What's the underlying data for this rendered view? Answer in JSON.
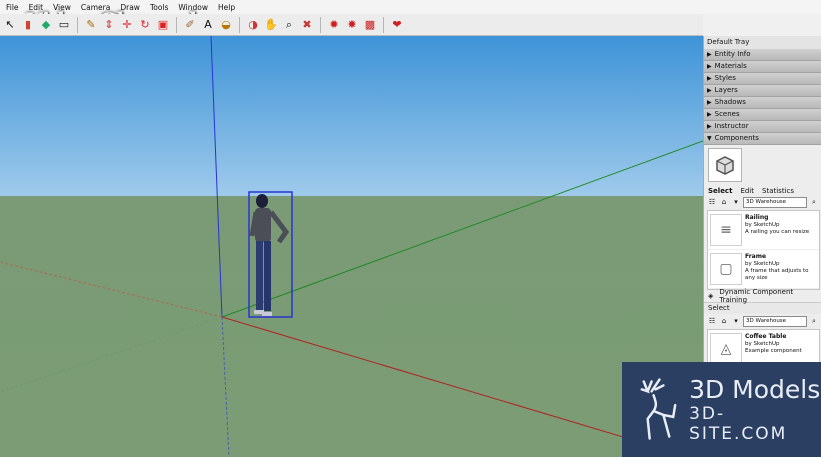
{
  "menu": [
    "File",
    "Edit",
    "View",
    "Camera",
    "Draw",
    "Tools",
    "Window",
    "Help"
  ],
  "toolbar_groups": [
    [
      "select-icon",
      "eraser-icon",
      "paint-bucket-icon",
      "rectangle-icon"
    ],
    [
      "pencil-icon",
      "push-pull-icon",
      "move-icon",
      "rotate-icon",
      "scale-icon"
    ],
    [
      "tape-measure-icon",
      "text-icon",
      "paint-icon"
    ],
    [
      "orbit-icon",
      "pan-icon",
      "zoom-icon",
      "zoom-extents-icon"
    ],
    [
      "warehouse-icon",
      "share-model-icon",
      "components-icon"
    ],
    [
      "extension-icon"
    ]
  ],
  "overlay_badge": "Video Channel",
  "tray": {
    "title": "Default Tray",
    "panels": [
      "Entity Info",
      "Materials",
      "Styles",
      "Layers",
      "Shadows",
      "Scenes",
      "Instructor"
    ],
    "components_panel": "Components",
    "tabs": [
      "Select",
      "Edit",
      "Statistics"
    ],
    "search_value": "3D Warehouse",
    "items": [
      {
        "name": "Railing",
        "author": "by SketchUp",
        "desc": "A railing you can resize"
      },
      {
        "name": "Frame",
        "author": "by SketchUp",
        "desc": "A frame that adjusts to any size"
      }
    ],
    "footer_label": "Dynamic Component Training",
    "second_section": "Select",
    "second_search": "3D Warehouse",
    "second_item": {
      "name": "Coffee Table",
      "author": "by SketchUp",
      "desc": "Example component"
    }
  },
  "watermark": {
    "main": "3D Models",
    "sub": "3D-SITE.COM"
  }
}
